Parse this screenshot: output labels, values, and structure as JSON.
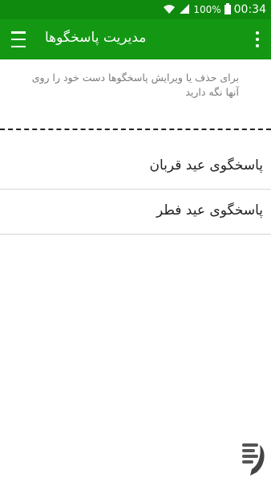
{
  "status_bar": {
    "battery_percent": "100%",
    "time": "00:34",
    "icons": [
      "wifi-icon",
      "signal-icon",
      "battery-icon"
    ]
  },
  "app_bar": {
    "title": "مدیریت پاسخگوها",
    "icons": [
      "menu-icon",
      "more-vert-icon"
    ]
  },
  "intro_text": "برای حذف یا ویرایش پاسخگوها دست خود را روی آنها نگه دارید",
  "items": [
    {
      "label": "پاسخگوی عید قربان"
    },
    {
      "label": "پاسخگوی عید فطر"
    }
  ],
  "colors": {
    "status_bar": "#0f8a0f",
    "app_bar": "#149814",
    "divider": "#d6d6d6"
  }
}
